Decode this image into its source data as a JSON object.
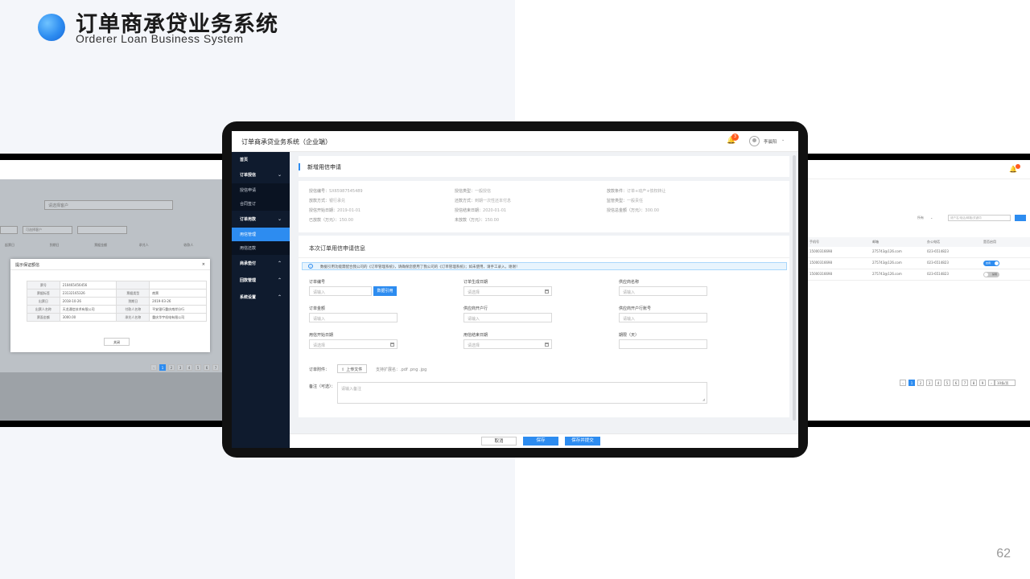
{
  "slide": {
    "title": "订单商承贷业务系统",
    "subtitle": "Orderer Loan Business System",
    "page_number": "62",
    "accent_color": "#2d8cf0",
    "left_panel_bg": "#f4f6fa"
  },
  "left_screen": {
    "select_placeholder": "请选择客户",
    "filter_placeholder": "可选择客户",
    "columns": [
      "起票日",
      "到期日",
      "票据金额",
      "承兑人",
      "收款人"
    ],
    "modal": {
      "title": "提示保证额信",
      "close_glyph": "×",
      "rows": [
        [
          "票号",
          "210465456456",
          "",
          ""
        ],
        [
          "票据标签",
          "23132165326",
          "票据类型",
          "商票"
        ],
        [
          "出票日",
          "2018-10-26",
          "到期日",
          "2019-03-26"
        ],
        [
          "出票人名称",
          "天龙通信技术有限公司",
          "付款人名称",
          "平安银行重庆南岸分行"
        ],
        [
          "票面金额",
          "3000.00",
          "承兑人名称",
          "重庆华宇机电有限公司"
        ]
      ],
      "close_label": "关闭"
    },
    "pages": [
      "‹",
      "1",
      "2",
      "3",
      "4",
      "5",
      "6",
      "7"
    ]
  },
  "right_screen": {
    "badge": "3",
    "filter_label": "所有",
    "search_placeholder": "请户名/电话/邮箱/关键词",
    "columns": [
      "手机号",
      "邮箱",
      "办公电话",
      "是否启用"
    ],
    "rows": [
      {
        "phone": "15000316698",
        "email": "275743@126.com",
        "office": "023-6514823",
        "toggle": "",
        "state": "none"
      },
      {
        "phone": "15000316698",
        "email": "275743@126.com",
        "office": "023-6514823",
        "toggle": "启用",
        "state": "on"
      },
      {
        "phone": "15000316698",
        "email": "275743@126.com",
        "office": "023-6514823",
        "toggle": "禁用",
        "state": "off"
      }
    ],
    "pages": [
      "‹",
      "1",
      "2",
      "3",
      "4",
      "5",
      "6",
      "7",
      "8",
      "9",
      "›"
    ],
    "page_size": "10条/页"
  },
  "app": {
    "title": "订单商承贷业务系统（企业端）",
    "notifications": "3",
    "user_name": "李晨阳",
    "sidebar": {
      "home": "首页",
      "groups": [
        {
          "label": "订单授信",
          "chevron": "⌄",
          "items": [
            "授信申请",
            "合同签订"
          ]
        },
        {
          "label": "订单用款",
          "chevron": "⌄",
          "items": [
            "用信管理",
            "用信还款"
          ]
        },
        {
          "label": "商承垫付",
          "chevron": "⌃",
          "items": []
        },
        {
          "label": "回款管理",
          "chevron": "⌃",
          "items": []
        },
        {
          "label": "系统设置",
          "chevron": "⌃",
          "items": []
        }
      ],
      "active_item": "用信管理"
    },
    "page_title": "新增用信申请",
    "info": [
      {
        "label": "授信编号：",
        "value": "SX65987545489"
      },
      {
        "label": "授信类型：",
        "value": "一般授信"
      },
      {
        "label": "放款条件：",
        "value": "订单+动产+债权转让"
      },
      {
        "label": "放款方式：",
        "value": "银行承兑"
      },
      {
        "label": "还款方式：",
        "value": "到期一次性还本付息"
      },
      {
        "label": "监管类型：",
        "value": "一般责任"
      },
      {
        "label": "授信开始日期：",
        "value": "2019-01-01"
      },
      {
        "label": "授信结束日期：",
        "value": "2020-01-01"
      },
      {
        "label": "授信总金额（万元）：",
        "value": "300.00"
      },
      {
        "label": "已放款（万元）：",
        "value": "150.00"
      },
      {
        "label": "未放款（万元）：",
        "value": "150.00"
      }
    ],
    "form": {
      "section_title": "本次订单用信申请信息",
      "alert": "数据引用功能需配合我公司的《订单管理系统》，请确保您使用了我公司的《订单管理系统》；如未使用，请手工录入，谢谢！",
      "fields": [
        {
          "label": "订单编号",
          "placeholder": "请输入",
          "kind": "input"
        },
        {
          "label": "订单生成日期",
          "placeholder": "请选择",
          "kind": "date"
        },
        {
          "label": "供应商名称",
          "placeholder": "请输入",
          "kind": "input"
        },
        {
          "label": "订单金额",
          "placeholder": "请输入",
          "kind": "input"
        },
        {
          "label": "供应商开户行",
          "placeholder": "请输入",
          "kind": "input"
        },
        {
          "label": "供应商开户行账号",
          "placeholder": "请输入",
          "kind": "input"
        },
        {
          "label": "用信开始日期",
          "placeholder": "请选择",
          "kind": "date"
        },
        {
          "label": "用信结束日期",
          "placeholder": "请选择",
          "kind": "date"
        },
        {
          "label": "期限（天）",
          "placeholder": "",
          "kind": "input"
        }
      ],
      "cite_button": "数据引用",
      "attachment_label": "订单附件：",
      "upload_label": "上传文件",
      "upload_hint": "支持扩展名：.pdf .png .jpg",
      "remark_label": "备注（可选）：",
      "remark_placeholder": "请输入备注"
    },
    "footer": {
      "cancel": "取消",
      "save": "保存",
      "save_submit": "保存并提交"
    }
  }
}
